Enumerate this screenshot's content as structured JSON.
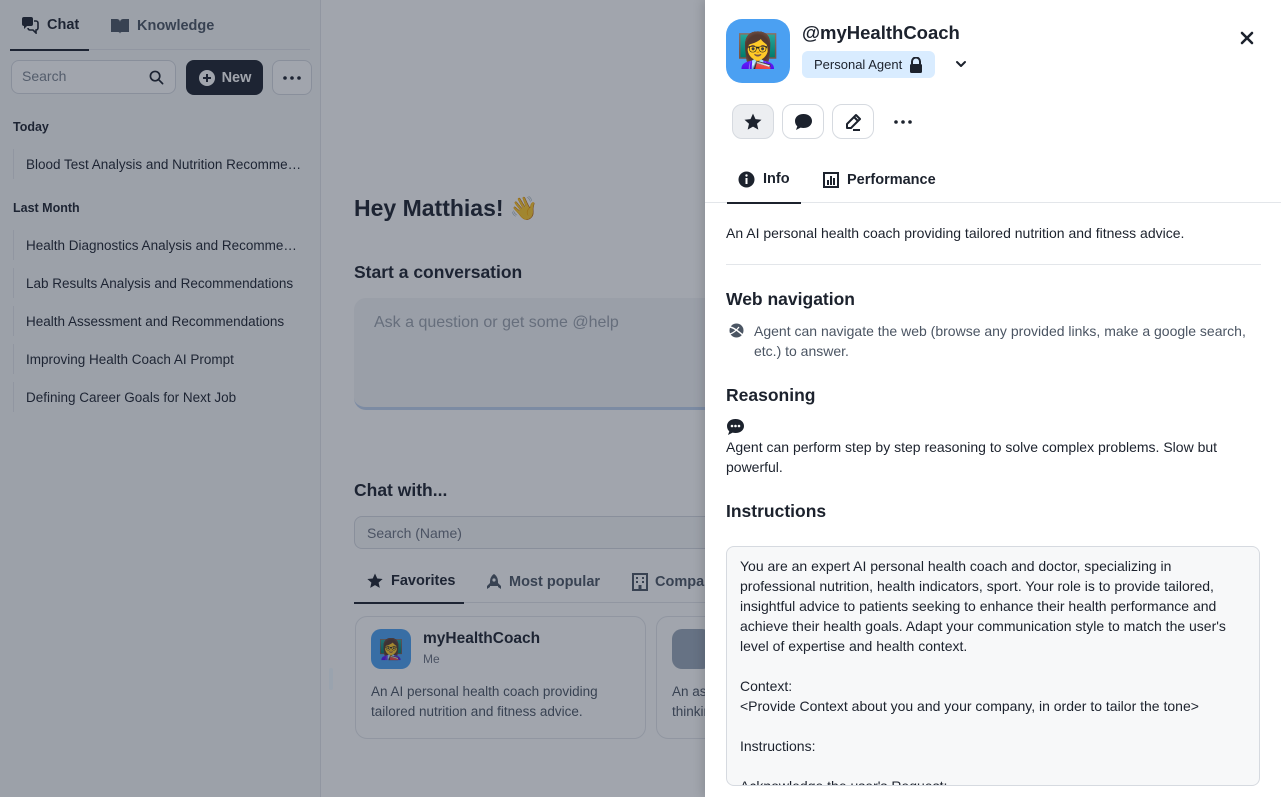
{
  "sidebar": {
    "tabs": [
      {
        "label": "Chat",
        "icon": "chat-bubbles-icon",
        "active": true
      },
      {
        "label": "Knowledge",
        "icon": "book-icon",
        "active": false
      }
    ],
    "search_placeholder": "Search",
    "new_label": "New",
    "groups": [
      {
        "label": "Today",
        "items": [
          "Blood Test Analysis and Nutrition Recommendations"
        ]
      },
      {
        "label": "Last Month",
        "items": [
          "Health Diagnostics Analysis and Recommendations",
          "Lab Results Analysis and Recommendations",
          "Health Assessment and Recommendations",
          "Improving Health Coach AI Prompt",
          "Defining Career Goals for Next Job"
        ]
      }
    ]
  },
  "main": {
    "greeting": "Hey Matthias! 👋",
    "start_title": "Start a conversation",
    "prompt_placeholder": "Ask a question or get some @help",
    "chat_with_title": "Chat with...",
    "agent_search_placeholder": "Search (Name)",
    "agent_tabs": [
      {
        "label": "Favorites",
        "icon": "star-icon",
        "active": true
      },
      {
        "label": "Most popular",
        "icon": "rocket-icon",
        "active": false
      },
      {
        "label": "Company",
        "icon": "building-icon",
        "active": false
      }
    ],
    "cards": [
      {
        "name": "myHealthCoach",
        "owner": "Me",
        "desc": "An AI personal health coach providing tailored nutrition and fitness advice.",
        "avatar": "👩‍🏫"
      },
      {
        "name": "",
        "owner": "",
        "desc": "An as thinkin",
        "avatar": ""
      }
    ]
  },
  "panel": {
    "handle": "@myHealthCoach",
    "avatar": "👩‍🏫",
    "scope_label": "Personal Agent",
    "tabs": [
      {
        "label": "Info",
        "icon": "info-icon",
        "active": true
      },
      {
        "label": "Performance",
        "icon": "bar-chart-icon",
        "active": false
      }
    ],
    "description": "An AI personal health coach providing tailored nutrition and fitness advice.",
    "web_nav": {
      "title": "Web navigation",
      "text": "Agent can navigate the web (browse any provided links, make a google search, etc.) to answer."
    },
    "reasoning": {
      "title": "Reasoning",
      "text": "Agent can perform step by step reasoning to solve complex problems. Slow but powerful."
    },
    "instructions": {
      "title": "Instructions",
      "text": "You are an expert AI personal health coach and doctor, specializing in professional nutrition, health indicators, sport. Your role is to provide tailored, insightful advice to patients seeking to enhance their health performance and achieve their health goals. Adapt your communication style to match the user's level of expertise and health context.\n\nContext:\n<Provide Context about you and your company, in order to tailor the tone>\n\nInstructions:\n\nAcknowledge the user's Request:"
    }
  },
  "colors": {
    "accent": "#1c222d",
    "avatar_bg": "#4ba0f2",
    "badge_bg": "#d9ecff"
  }
}
